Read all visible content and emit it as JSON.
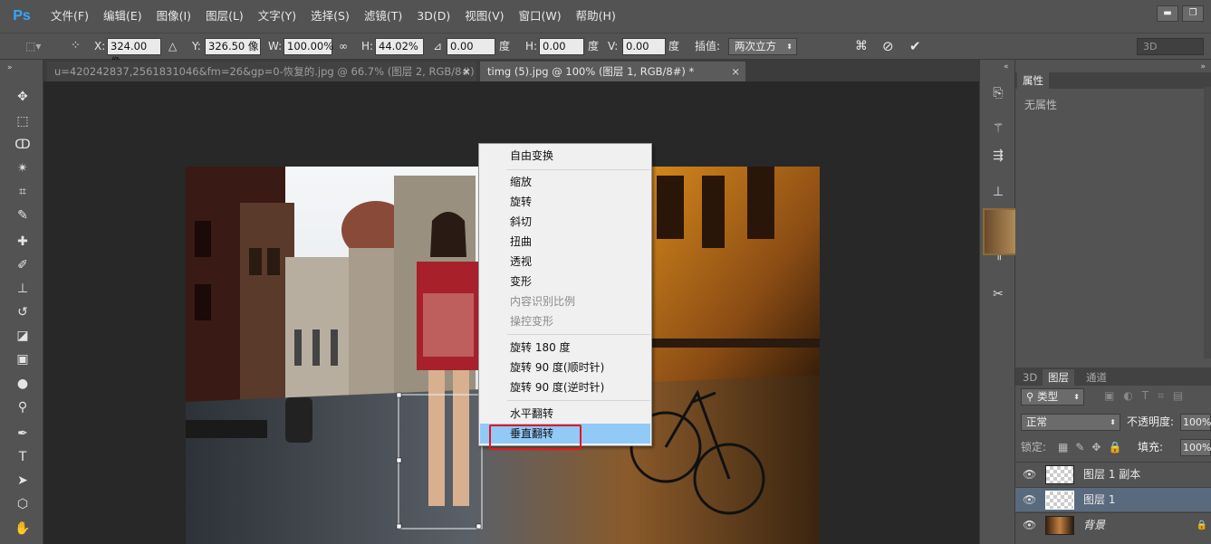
{
  "app": {
    "logo": "Ps"
  },
  "menu": [
    "文件(F)",
    "编辑(E)",
    "图像(I)",
    "图层(L)",
    "文字(Y)",
    "选择(S)",
    "滤镜(T)",
    "3D(D)",
    "视图(V)",
    "窗口(W)",
    "帮助(H)"
  ],
  "window_controls": {
    "minimize": "▬",
    "restore": "❐"
  },
  "options": {
    "x_label": "X:",
    "x_value": "324.00 像",
    "y_label": "Y:",
    "y_value": "326.50 像",
    "w_label": "W:",
    "w_value": "100.00%",
    "h_label": "H:",
    "h_value": "44.02%",
    "angle_value": "0.00",
    "angle_unit": "度",
    "hskew_label": "H:",
    "hskew_value": "0.00",
    "hskew_unit": "度",
    "vskew_label": "V:",
    "vskew_value": "0.00",
    "vskew_unit": "度",
    "interp_label": "插值:",
    "interp_value": "两次立方",
    "workspace": "3D"
  },
  "tabs": [
    {
      "label": "u=420242837,2561831046&fm=26&gp=0-恢复的.jpg @ 66.7% (图层 2, RGB/8#) *",
      "close": "×"
    },
    {
      "label": "timg (5).jpg @ 100% (图层 1, RGB/8#) *",
      "close": "×"
    }
  ],
  "context_menu": {
    "items": [
      {
        "label": "自由变换",
        "enabled": true
      },
      {
        "label": "缩放",
        "enabled": true
      },
      {
        "label": "旋转",
        "enabled": true
      },
      {
        "label": "斜切",
        "enabled": true
      },
      {
        "label": "扭曲",
        "enabled": true
      },
      {
        "label": "透视",
        "enabled": true
      },
      {
        "label": "变形",
        "enabled": true
      },
      {
        "label": "内容识别比例",
        "enabled": false
      },
      {
        "label": "操控变形",
        "enabled": false
      },
      {
        "label": "旋转 180 度",
        "enabled": true
      },
      {
        "label": "旋转 90 度(顺时针)",
        "enabled": true
      },
      {
        "label": "旋转 90 度(逆时针)",
        "enabled": true
      },
      {
        "label": "水平翻转",
        "enabled": true
      },
      {
        "label": "垂直翻转",
        "enabled": true,
        "highlighted": true
      }
    ]
  },
  "properties_panel": {
    "tab": "属性",
    "empty_text": "无属性"
  },
  "layers_panel": {
    "tabs": [
      "3D",
      "图层",
      "通道"
    ],
    "filter_label": "类型",
    "blend_mode": "正常",
    "opacity_label": "不透明度:",
    "opacity_value": "100%",
    "lock_label": "锁定:",
    "fill_label": "填充:",
    "fill_value": "100%",
    "layers": [
      {
        "name": "图层 1 副本",
        "selected": false
      },
      {
        "name": "图层 1",
        "selected": true
      },
      {
        "name": "背景",
        "selected": false,
        "locked": true
      }
    ]
  },
  "colors": {
    "accent": "#31a8ff",
    "highlight": "#91c9f7",
    "annotation": "#e8141d"
  }
}
